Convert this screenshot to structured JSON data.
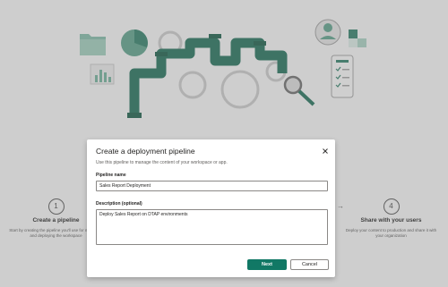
{
  "colors": {
    "accent": "#117865",
    "pipe": "#1f6e57",
    "overlay": "rgba(128,128,128,0.32)"
  },
  "steps": [
    {
      "number": "1",
      "title": "Create a pipeline",
      "desc": "Start by creating the pipeline you'll use for managing and deploying the workspace"
    },
    {
      "number": "4",
      "title": "Share with your users",
      "desc": "Deploy your content to production and share it with your organization"
    }
  ],
  "dialog": {
    "title": "Create a deployment pipeline",
    "subtitle": "Use this pipeline to manage the content of your workspace or app.",
    "close_icon": "close-icon",
    "name_label": "Pipeline name",
    "name_value": "Sales Report Deployment",
    "desc_label": "Description (optional)",
    "desc_value": "Deploy Sales Report on DTAP environments",
    "next_label": "Next",
    "cancel_label": "Cancel"
  }
}
